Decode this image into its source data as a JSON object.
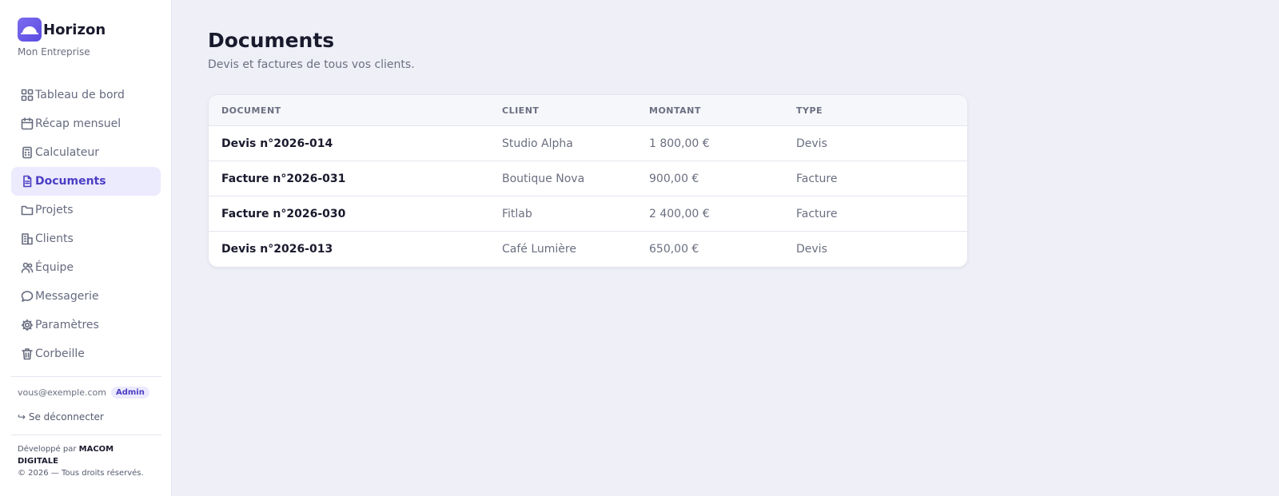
{
  "brand": {
    "name": "Horizon",
    "company": "Mon Entreprise"
  },
  "nav": [
    {
      "label": "Tableau de bord",
      "icon": "grid-icon"
    },
    {
      "label": "Récap mensuel",
      "icon": "calendar-icon"
    },
    {
      "label": "Calculateur",
      "icon": "calculator-icon"
    },
    {
      "label": "Documents",
      "icon": "document-icon",
      "active": true
    },
    {
      "label": "Projets",
      "icon": "folder-icon"
    },
    {
      "label": "Clients",
      "icon": "building-icon"
    },
    {
      "label": "Équipe",
      "icon": "users-icon"
    },
    {
      "label": "Messagerie",
      "icon": "message-icon"
    },
    {
      "label": "Paramètres",
      "icon": "gear-icon"
    },
    {
      "label": "Corbeille",
      "icon": "trash-icon"
    }
  ],
  "user": {
    "email": "vous@exemple.com",
    "role": "Admin",
    "logout": "↪ Se déconnecter"
  },
  "footer": {
    "developed_by": "Développé par",
    "company": "MACOM DIGITALE",
    "copyright": "© 2026 — Tous droits réservés."
  },
  "page": {
    "title": "Documents",
    "subtitle": "Devis et factures de tous vos clients."
  },
  "table": {
    "headers": [
      "DOCUMENT",
      "CLIENT",
      "MONTANT",
      "TYPE"
    ],
    "rows": [
      [
        "Devis n°2026-014",
        "Studio Alpha",
        "1 800,00 €",
        "Devis"
      ],
      [
        "Facture n°2026-031",
        "Boutique Nova",
        "900,00 €",
        "Facture"
      ],
      [
        "Facture n°2026-030",
        "Fitlab",
        "2 400,00 €",
        "Facture"
      ],
      [
        "Devis n°2026-013",
        "Café Lumière",
        "650,00 €",
        "Devis"
      ]
    ]
  },
  "colors": {
    "accent": "#4b3ec4",
    "accent_bg": "#eceafd",
    "background": "#eff0f7"
  }
}
